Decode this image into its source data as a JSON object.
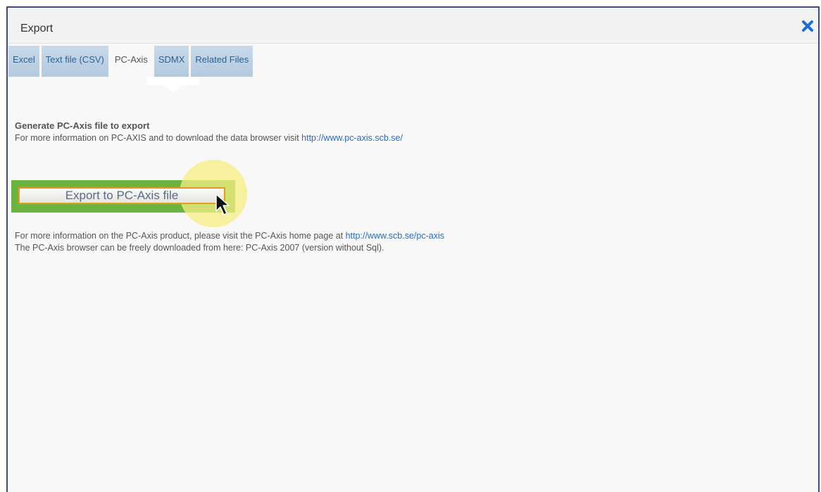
{
  "dialog": {
    "title": "Export",
    "close_icon": "close-icon",
    "accent_color": "#3f4a86"
  },
  "tabs": [
    {
      "label": "Excel"
    },
    {
      "label": "Text file (CSV)"
    },
    {
      "label": "PC-Axis"
    },
    {
      "label": "SDMX"
    },
    {
      "label": "Related Files"
    }
  ],
  "active_tab": "PC-Axis",
  "content": {
    "heading": "Generate PC-Axis file to export",
    "info_prefix": "For more information on PC-AXIS and to download the data browser visit ",
    "info_link": "http://www.pc-axis.scb.se/",
    "export_button_label": "Export to PC-Axis file",
    "product_prefix": "For more information on the PC-Axis product, please visit the PC-Axis home page at ",
    "product_link": "http://www.scb.se/pc-axis",
    "browser_text": "The PC-Axis browser can be freely downloaded from here: PC-Axis 2007 (version without Sql)."
  }
}
